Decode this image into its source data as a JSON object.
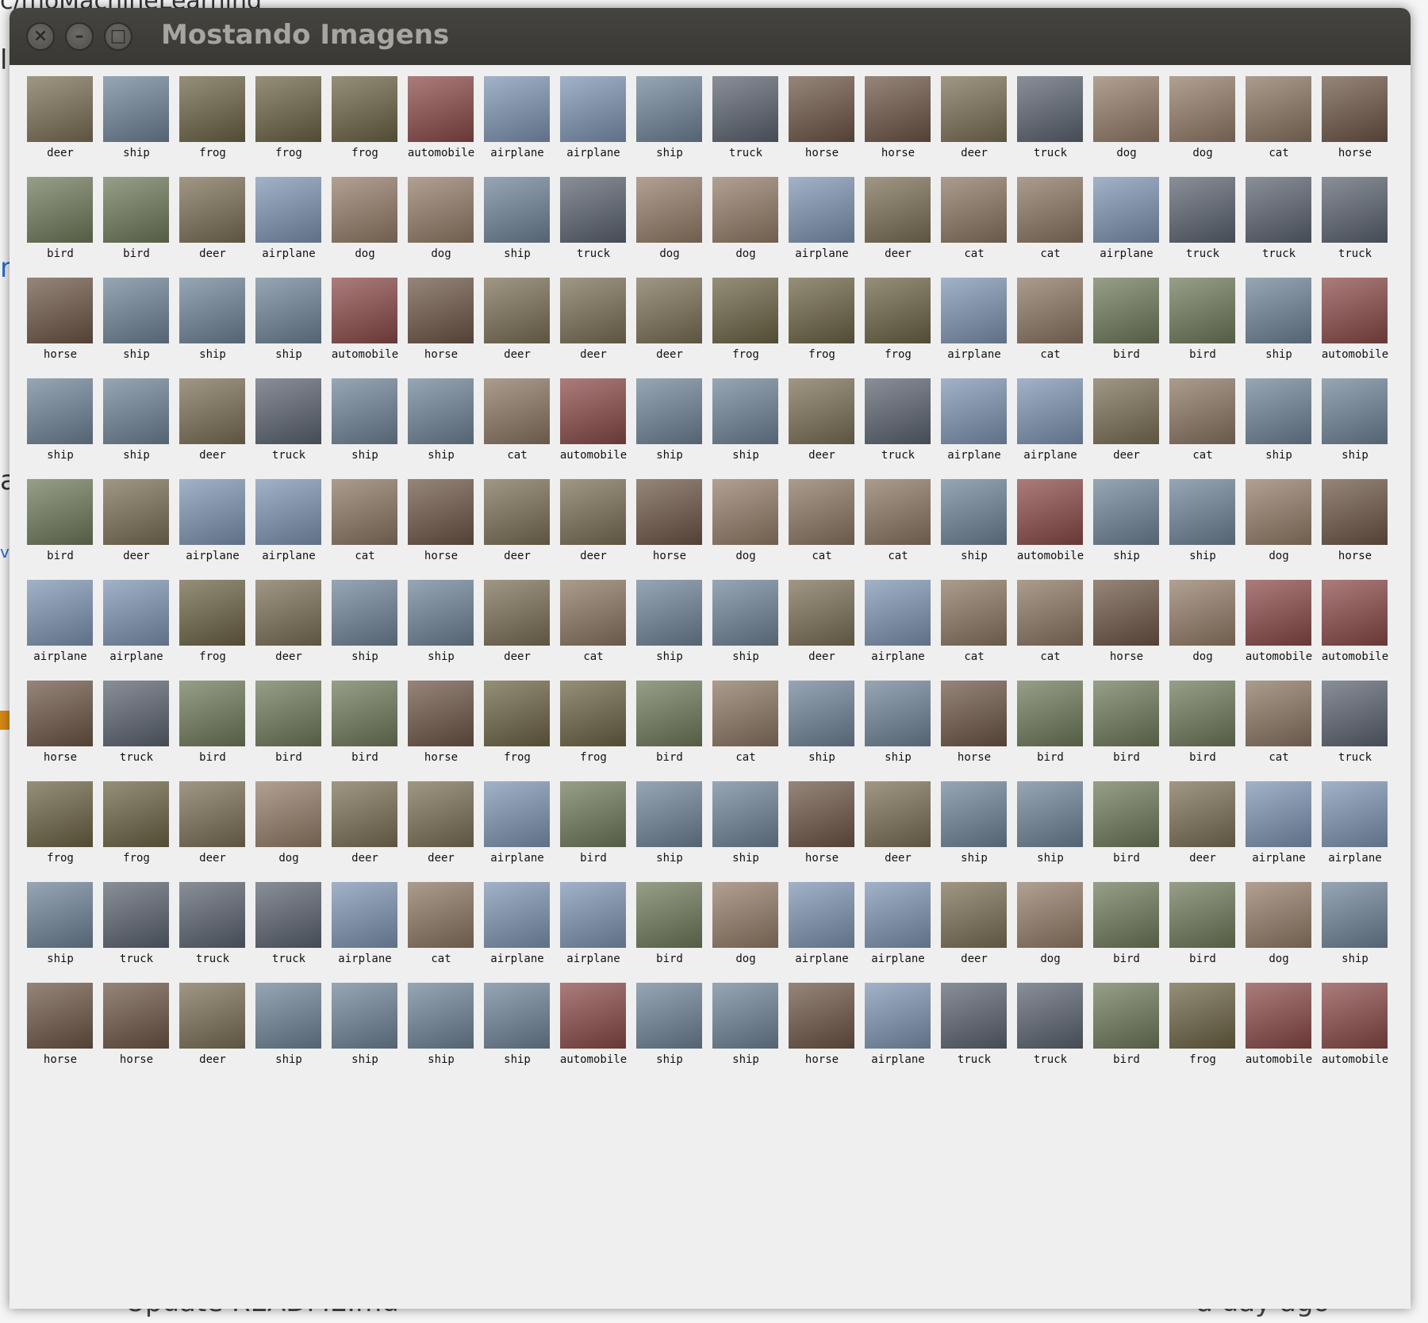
{
  "background": {
    "top_text": "c/moMachineLearning",
    "left_glyphs": [
      "l",
      "r",
      "a",
      "v"
    ],
    "bottom_left_text": "Update README.md",
    "bottom_right_text": "a day ago"
  },
  "window": {
    "title": "Mostando Imagens",
    "buttons": {
      "close": "×",
      "minimize": "–",
      "maximize": "□"
    }
  },
  "grid": {
    "rows": [
      [
        "deer",
        "ship",
        "frog",
        "frog",
        "frog",
        "automobile",
        "airplane",
        "airplane",
        "ship",
        "truck",
        "horse",
        "horse",
        "deer",
        "truck",
        "dog",
        "dog",
        "cat",
        "horse"
      ],
      [
        "bird",
        "bird",
        "deer",
        "airplane",
        "dog",
        "dog",
        "ship",
        "truck",
        "dog",
        "dog",
        "airplane",
        "deer",
        "cat",
        "cat",
        "airplane",
        "truck",
        "truck",
        "truck"
      ],
      [
        "horse",
        "ship",
        "ship",
        "ship",
        "automobile",
        "horse",
        "deer",
        "deer",
        "deer",
        "frog",
        "frog",
        "frog",
        "airplane",
        "cat",
        "bird",
        "bird",
        "ship",
        "automobile"
      ],
      [
        "ship",
        "ship",
        "deer",
        "truck",
        "ship",
        "ship",
        "cat",
        "automobile",
        "ship",
        "ship",
        "deer",
        "truck",
        "airplane",
        "airplane",
        "deer",
        "cat",
        "ship",
        "ship"
      ],
      [
        "bird",
        "deer",
        "airplane",
        "airplane",
        "cat",
        "horse",
        "deer",
        "deer",
        "horse",
        "dog",
        "cat",
        "cat",
        "ship",
        "automobile",
        "ship",
        "ship",
        "dog",
        "horse"
      ],
      [
        "airplane",
        "airplane",
        "frog",
        "deer",
        "ship",
        "ship",
        "deer",
        "cat",
        "ship",
        "ship",
        "deer",
        "airplane",
        "cat",
        "cat",
        "horse",
        "dog",
        "automobile",
        "automobile"
      ],
      [
        "horse",
        "truck",
        "bird",
        "bird",
        "bird",
        "horse",
        "frog",
        "frog",
        "bird",
        "cat",
        "ship",
        "ship",
        "horse",
        "bird",
        "bird",
        "bird",
        "cat",
        "truck"
      ],
      [
        "frog",
        "frog",
        "deer",
        "dog",
        "deer",
        "deer",
        "airplane",
        "bird",
        "ship",
        "ship",
        "horse",
        "deer",
        "ship",
        "ship",
        "bird",
        "deer",
        "airplane",
        "airplane"
      ],
      [
        "ship",
        "truck",
        "truck",
        "truck",
        "airplane",
        "cat",
        "airplane",
        "airplane",
        "bird",
        "dog",
        "airplane",
        "airplane",
        "deer",
        "dog",
        "bird",
        "bird",
        "dog",
        "ship"
      ],
      [
        "horse",
        "horse",
        "deer",
        "ship",
        "ship",
        "ship",
        "ship",
        "automobile",
        "ship",
        "ship",
        "horse",
        "airplane",
        "truck",
        "truck",
        "bird",
        "frog",
        "automobile",
        "automobile"
      ]
    ],
    "thumb_colors": {
      "airplane": "#7e95b3",
      "automobile": "#8a4a48",
      "bird": "#6f7a5a",
      "cat": "#8c7662",
      "deer": "#7b7055",
      "dog": "#947d68",
      "frog": "#6d6445",
      "horse": "#6e5646",
      "ship": "#6f8498",
      "truck": "#5c6470"
    }
  }
}
